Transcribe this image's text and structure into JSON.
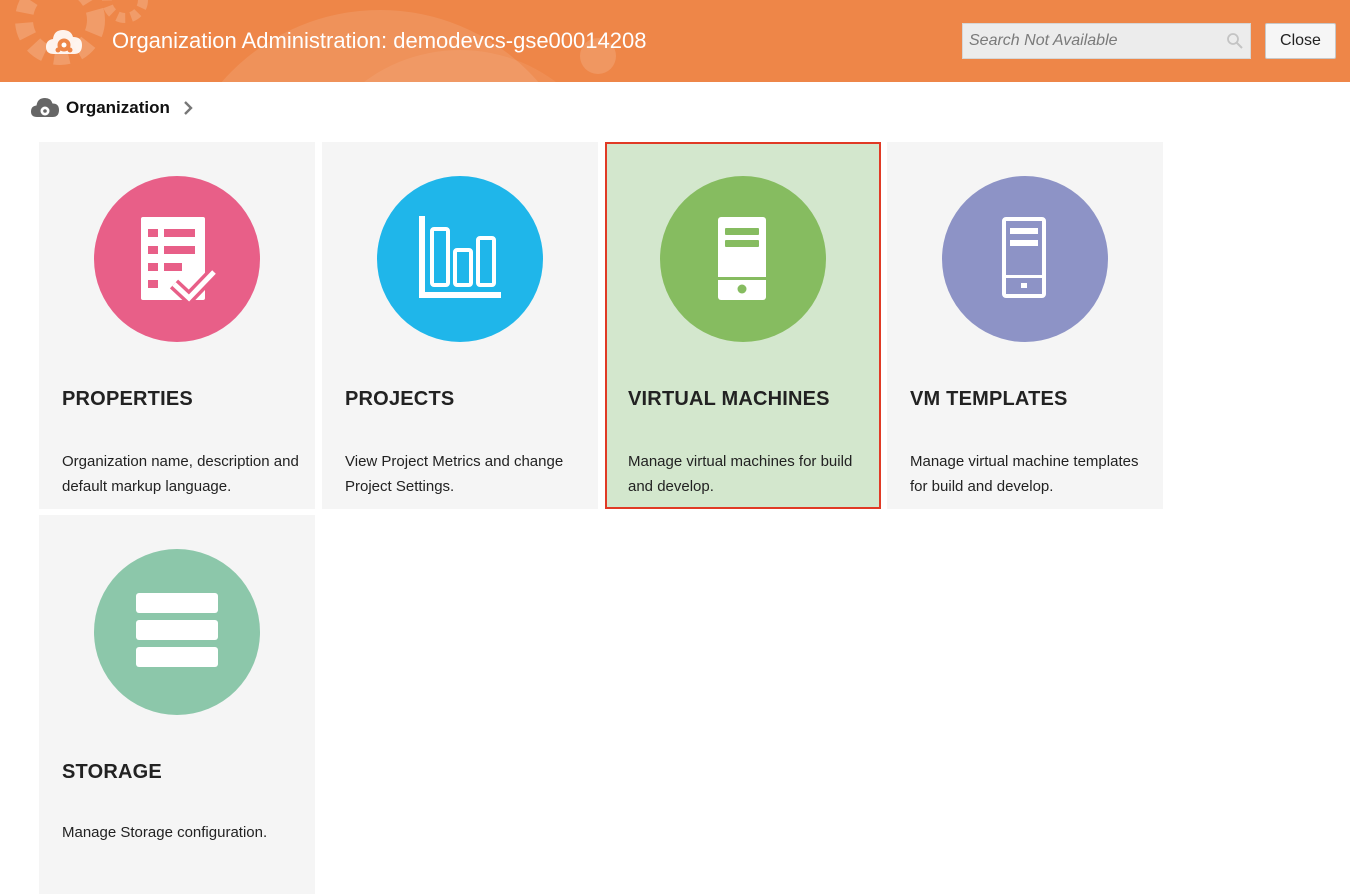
{
  "header": {
    "title": "Organization Administration: demodevcs-gse00014208",
    "search_placeholder": "Search Not Available",
    "close_label": "Close",
    "bg_color": "#ee8648"
  },
  "breadcrumb": {
    "label": "Organization",
    "icon": "cloud-icon",
    "separator_icon": "chevron-right-icon"
  },
  "cards": [
    {
      "title": "PROPERTIES",
      "desc": "Organization name, description and default markup language.",
      "icon": "checklist-icon",
      "color": "#e85f88",
      "selected": false
    },
    {
      "title": "PROJECTS",
      "desc": "View Project Metrics and change Project Settings.",
      "icon": "bar-chart-icon",
      "color": "#1fb6ea",
      "selected": false
    },
    {
      "title": "VIRTUAL MACHINES",
      "desc": "Manage virtual machines for build and develop.",
      "icon": "server-icon",
      "color": "#86bc60",
      "selected": true
    },
    {
      "title": "VM TEMPLATES",
      "desc": "Manage virtual machine templates for build and develop.",
      "icon": "server-outline-icon",
      "color": "#8d93c6",
      "selected": false
    },
    {
      "title": "STORAGE",
      "desc": "Manage Storage configuration.",
      "icon": "storage-stack-icon",
      "color": "#8cc7aa",
      "selected": false
    }
  ]
}
